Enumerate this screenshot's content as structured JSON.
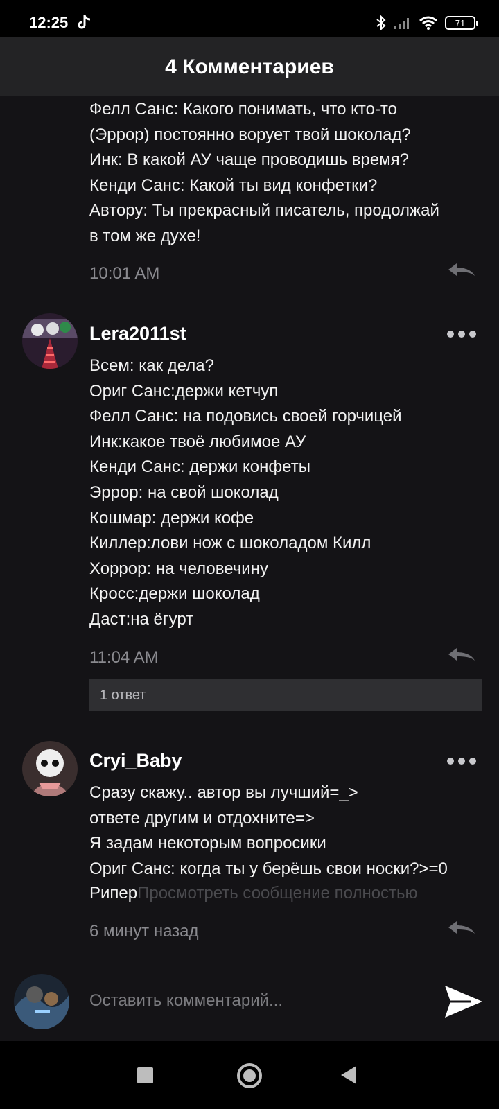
{
  "status_bar": {
    "time": "12:25",
    "battery": "71"
  },
  "header": {
    "title": "4 Комментариев"
  },
  "comments": [
    {
      "text": "Фелл Санс: Какого понимать, что кто-то\n(Эррор) постоянно ворует твой шоколад?\nИнк: В какой АУ чаще проводишь время?\nКенди Санс: Какой ты вид конфетки?\nАвтору: Ты прекрасный писатель, продолжай\nв том же духе!",
      "time": "10:01 AM"
    },
    {
      "username": "Lera2011st",
      "text": "Всем: как дела?\nОриг Санс:держи кетчуп\nФелл Санс: на подовись своей горчицей\nИнк:какое твоё любимое АУ\nКенди Санс: держи конфеты\nЭррор: на свой шоколад\nКошмар: держи кофе\nКиллер:лови нож с шоколадом Килл\nХоррор: на человечину\nКросс:держи шоколад\nДаст:на ёгурт",
      "time": "11:04 AM",
      "replies": "1 ответ"
    },
    {
      "username": "Cryi_Baby",
      "text": "Сразу скажу.. автор вы лучший=_>\nответе другим и отдохните=>\nЯ задам некоторым вопросики\nОриг Санс: когда ты у берёшь свои носки?>=0",
      "last_line": "Рипер",
      "see_full": "Просмотреть сообщение полностью",
      "time": "6 минут назад"
    }
  ],
  "composer": {
    "placeholder": "Оставить комментарий..."
  },
  "icons": [
    "tiktok-icon",
    "bluetooth-icon",
    "signal-icon",
    "wifi-icon",
    "battery-icon",
    "reply-icon",
    "more-icon",
    "send-icon",
    "recents-icon",
    "home-icon",
    "back-icon"
  ]
}
